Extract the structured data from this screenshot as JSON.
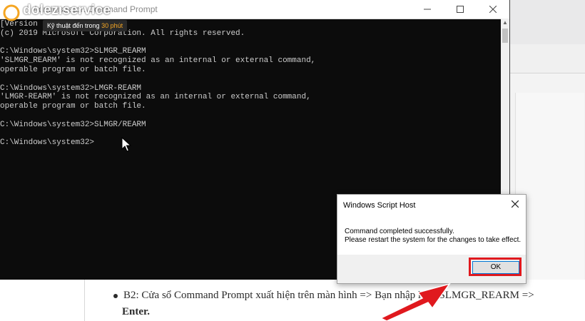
{
  "logo": {
    "name": "dolezıservice",
    "tagline_prefix": "Kỹ thuật đến trong ",
    "tagline_highlight": "30 phút"
  },
  "cmd": {
    "title": "Administrator: Command Prompt",
    "lines": [
      "[Version 10.0.18363.1316]",
      "(c) 2019 Microsoft Corporation. All rights reserved.",
      "",
      "C:\\Windows\\system32>SLMGR_REARM",
      "'SLMGR_REARM' is not recognized as an internal or external command,",
      "operable program or batch file.",
      "",
      "C:\\Windows\\system32>LMGR-REARM",
      "'LMGR-REARM' is not recognized as an internal or external command,",
      "operable program or batch file.",
      "",
      "C:\\Windows\\system32>SLMGR/REARM",
      "",
      "C:\\Windows\\system32>"
    ]
  },
  "dialog": {
    "title": "Windows Script Host",
    "message_line1": "Command completed successfully.",
    "message_line2": "Please restart the system for the changes to take effect.",
    "ok_label": "OK"
  },
  "article": {
    "line1": "B2: Cửa sổ Command Prompt xuất hiện trên màn hình => Bạn nhập lệnh SLMGR_REARM =>",
    "line2": "Enter."
  },
  "colors": {
    "console_bg": "#0c0c0c",
    "console_text": "#cccccc",
    "highlight_red": "#e0191e",
    "tagline_accent": "#f5a623"
  }
}
